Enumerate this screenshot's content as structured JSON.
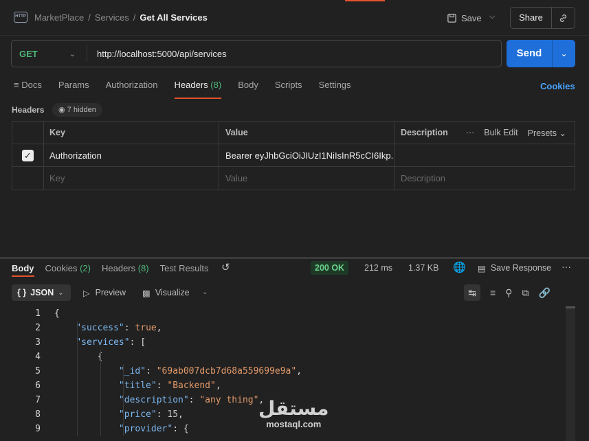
{
  "breadcrumb": {
    "workspace": "MarketPlace",
    "sep": "/",
    "folder": "Services",
    "request": "Get All Services"
  },
  "toolbar": {
    "save_label": "Save",
    "share_label": "Share"
  },
  "request": {
    "method": "GET",
    "url": "http://localhost:5000/api/services",
    "send_label": "Send"
  },
  "req_tabs": [
    {
      "label": "Docs"
    },
    {
      "label": "Params"
    },
    {
      "label": "Authorization"
    },
    {
      "label": "Headers",
      "count": "(8)"
    },
    {
      "label": "Body"
    },
    {
      "label": "Scripts"
    },
    {
      "label": "Settings"
    }
  ],
  "cookies_link": "Cookies",
  "headers": {
    "title": "Headers",
    "hidden_label": "7 hidden",
    "columns": {
      "key": "Key",
      "value": "Value",
      "description": "Description"
    },
    "bulk_edit": "Bulk Edit",
    "presets": "Presets",
    "rows": [
      {
        "checked": true,
        "key": "Authorization",
        "value": "Bearer eyJhbGciOiJIUzI1NiIsInR5cCI6Ikp...",
        "description": ""
      }
    ],
    "placeholder": {
      "key": "Key",
      "value": "Value",
      "description": "Description"
    }
  },
  "response": {
    "tabs": {
      "body": "Body",
      "cookies": "Cookies",
      "cookies_count": "(2)",
      "headers": "Headers",
      "headers_count": "(8)",
      "tests": "Test Results"
    },
    "status": "200 OK",
    "time": "212 ms",
    "size": "1.37 KB",
    "save_label": "Save Response",
    "format": "JSON",
    "format_icon": "{ }",
    "preview": "Preview",
    "visualize": "Visualize"
  },
  "code_lines": [
    {
      "n": "1",
      "t": "{"
    },
    {
      "n": "2",
      "t": "    \"success\": true,"
    },
    {
      "n": "3",
      "t": "    \"services\": ["
    },
    {
      "n": "4",
      "t": "        {"
    },
    {
      "n": "5",
      "t": "            \"_id\": \"69ab007dcb7d68a559699e9a\","
    },
    {
      "n": "6",
      "t": "            \"title\": \"Backend\","
    },
    {
      "n": "7",
      "t": "            \"description\": \"any thing\","
    },
    {
      "n": "8",
      "t": "            \"price\": 15,"
    },
    {
      "n": "9",
      "t": "            \"provider\": {"
    }
  ],
  "watermark": {
    "arabic": "مستقل",
    "latin": "mostaql.com"
  },
  "colors": {
    "accent": "#e5532d",
    "send": "#1e6fd9",
    "ok": "#6bd08c",
    "key": "#7cb7f0",
    "string": "#e39a6a"
  }
}
